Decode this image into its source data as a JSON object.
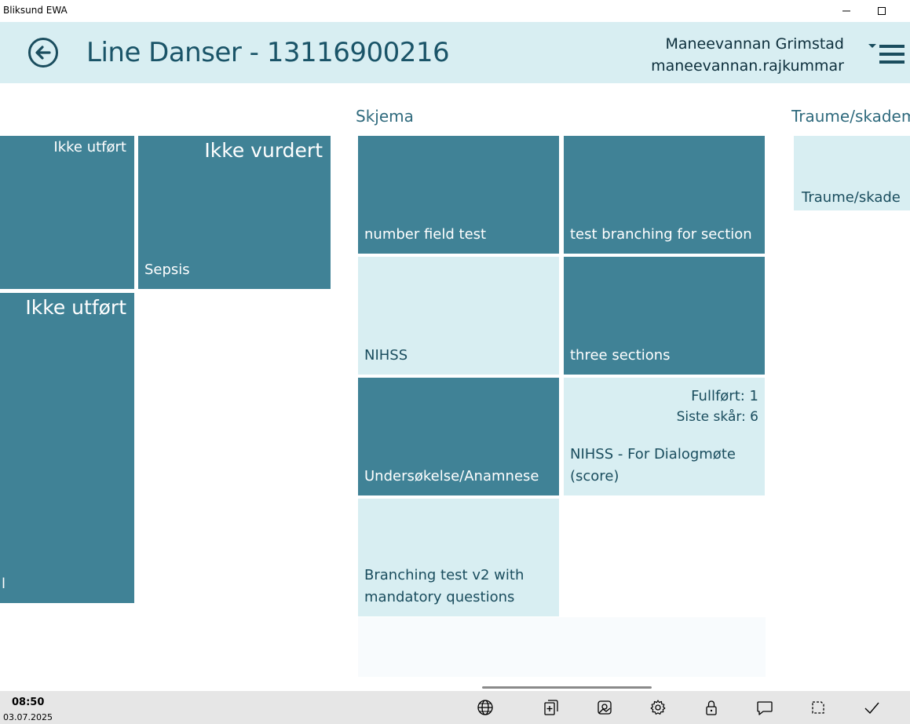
{
  "window": {
    "title": "Bliksund EWA"
  },
  "header": {
    "title": "Line Danser - 13116900216",
    "user_name": "Maneevannan Grimstad",
    "user_login": "maneevannan.rajkummar"
  },
  "left_tiles": {
    "tile1_status": "Ikke utført",
    "tile2_status": "Ikke vurdert",
    "tile2_label": "Sepsis",
    "tile3_status": "Ikke utført",
    "tile3_label": "l"
  },
  "skjema": {
    "heading": "Skjema",
    "tiles": [
      {
        "label": "number field test"
      },
      {
        "label": "test branching for section"
      },
      {
        "label": "NIHSS"
      },
      {
        "label": "three sections"
      },
      {
        "label": "Undersøkelse/Anamnese"
      },
      {
        "label": "NIHSS - For Dialogmøte (score)",
        "completed": "Fullført: 1",
        "last_score": "Siste skår: 6"
      },
      {
        "label": "Branching test v2 with mandatory questions"
      }
    ]
  },
  "traume": {
    "heading": "Traume/skademe",
    "tile_label": "Traume/skade"
  },
  "taskbar": {
    "time": "08:50",
    "date": "03.07.2025",
    "icons": [
      "globe-icon",
      "add-document-icon",
      "image-icon",
      "gear-icon",
      "lock-icon",
      "chat-icon",
      "crop-icon",
      "check-icon"
    ]
  },
  "colors": {
    "tile_dark": "#408296",
    "tile_light": "#d8eef2",
    "header_bg": "#d8eef2"
  }
}
